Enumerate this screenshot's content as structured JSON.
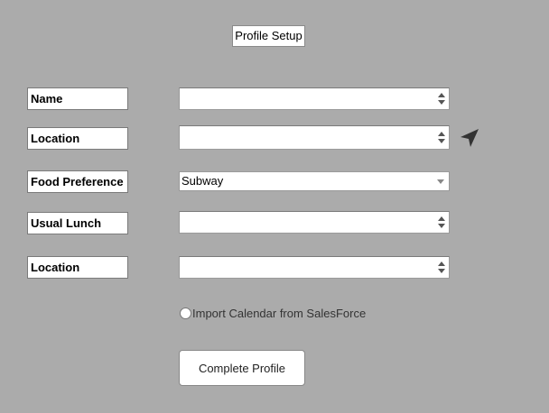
{
  "header": {
    "title": "Profile Setup"
  },
  "form": {
    "name": {
      "label": "Name",
      "value": ""
    },
    "location": {
      "label": "Location",
      "value": ""
    },
    "food_preference": {
      "label": "Food Preference",
      "selected": "Subway"
    },
    "usual_lunch": {
      "label": "Usual Lunch",
      "value": ""
    },
    "location2": {
      "label": "Location",
      "value": ""
    }
  },
  "import_calendar": {
    "label": "Import Calendar from SalesForce",
    "checked": false
  },
  "actions": {
    "complete_label": "Complete Profile"
  },
  "icons": {
    "location": "navigation-arrow-icon",
    "spinner": "spinner-arrows-icon",
    "select": "chevron-down-icon"
  }
}
